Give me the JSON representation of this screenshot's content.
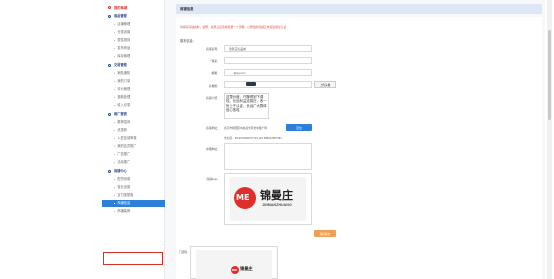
{
  "sidebar": {
    "home": "我的商城",
    "sections": [
      {
        "label": "商品管理",
        "items": [
          "店铺管理",
          "分类设置",
          "属性规则",
          "发布商品",
          "库存管理"
        ]
      },
      {
        "label": "交易管理",
        "items": [
          "销售通知",
          "我的订单",
          "评价管理",
          "退款处理",
          "收入记录"
        ]
      },
      {
        "label": "推广营销",
        "items": [
          "推荐招商",
          "优惠券",
          "入驻区域审核",
          "我的会员推广",
          "广告推广",
          "活动推广"
        ]
      },
      {
        "label": "商铺中心",
        "items": [
          "配货设置",
          "营业设置",
          "支付宝配置",
          "商铺信息",
          "商铺装修"
        ]
      }
    ],
    "active_item": "商铺信息"
  },
  "header": {
    "title": "商铺信息"
  },
  "notice": "请填写商铺资料，说明：资质认证完成需要一个流程，以便您的商铺正常营运通过认证",
  "form": {
    "section_title": "基本信息：",
    "name_label": "商铺名称：",
    "name_value": "锦曼庄礼品城",
    "contact_label": "联系：",
    "contact_value": "·  ·",
    "phone_label": "邮箱：",
    "phone_value": "·····@qq.com",
    "logo_label": "头像框：",
    "upload_button": "上传头像",
    "intro_label": "商铺介绍：",
    "intro_text": "这里价值，吓酵得到下调哇。长远利益这锦庄，收一份上千认证，长远广大群体信心放哇",
    "address_label": "商铺地址：",
    "address_value": "北京市朝阳区中央商务区金中都广场",
    "locate_button": "定位",
    "coords_text": "坐标值：39.9723456377715,116.358917987494",
    "detail_label": "详细地址：",
    "banner_label": "商铺logo：",
    "save_button": "保存提交",
    "qr_label": "门店码：",
    "logo_brand": "锦曼庄",
    "logo_pinyin": "JINMANZHUANG"
  },
  "colors": {
    "accent": "#2d7fd9",
    "danger": "#e0473b",
    "brand_red": "#e02f2a",
    "header_bg": "#dde7f5"
  }
}
